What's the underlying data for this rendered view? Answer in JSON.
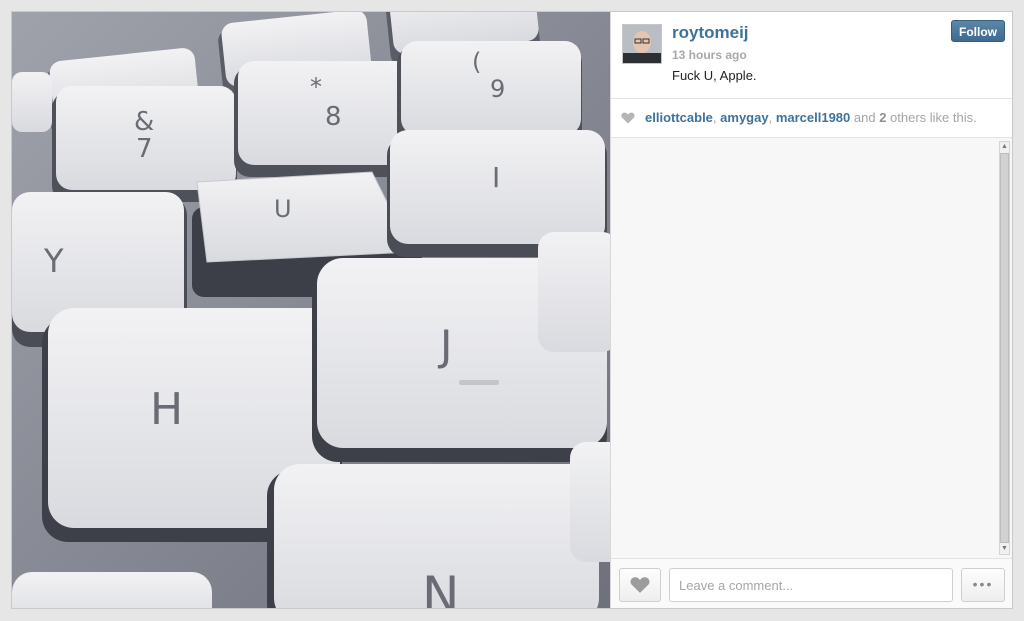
{
  "photo": {
    "description_icon": "keyboard-photo",
    "keys": [
      "&",
      "7",
      "*",
      "8",
      "(",
      "9",
      "U",
      "I",
      "Y",
      "H",
      "J",
      "N"
    ]
  },
  "post": {
    "username": "roytomeij",
    "time_ago": "13 hours ago",
    "caption": "Fuck U, Apple.",
    "follow_label": "Follow"
  },
  "likes": {
    "users": [
      "elliottcable",
      "amygay",
      "marcell1980"
    ],
    "sep": ", ",
    "and_text": " and ",
    "others_count": "2",
    "others_text": " others like this."
  },
  "comment": {
    "placeholder": "Leave a comment...",
    "value": "",
    "more_label": "•••"
  },
  "colors": {
    "link": "#3f729b",
    "follow_button": "#4a7aa0",
    "muted": "#a4a4a4"
  }
}
